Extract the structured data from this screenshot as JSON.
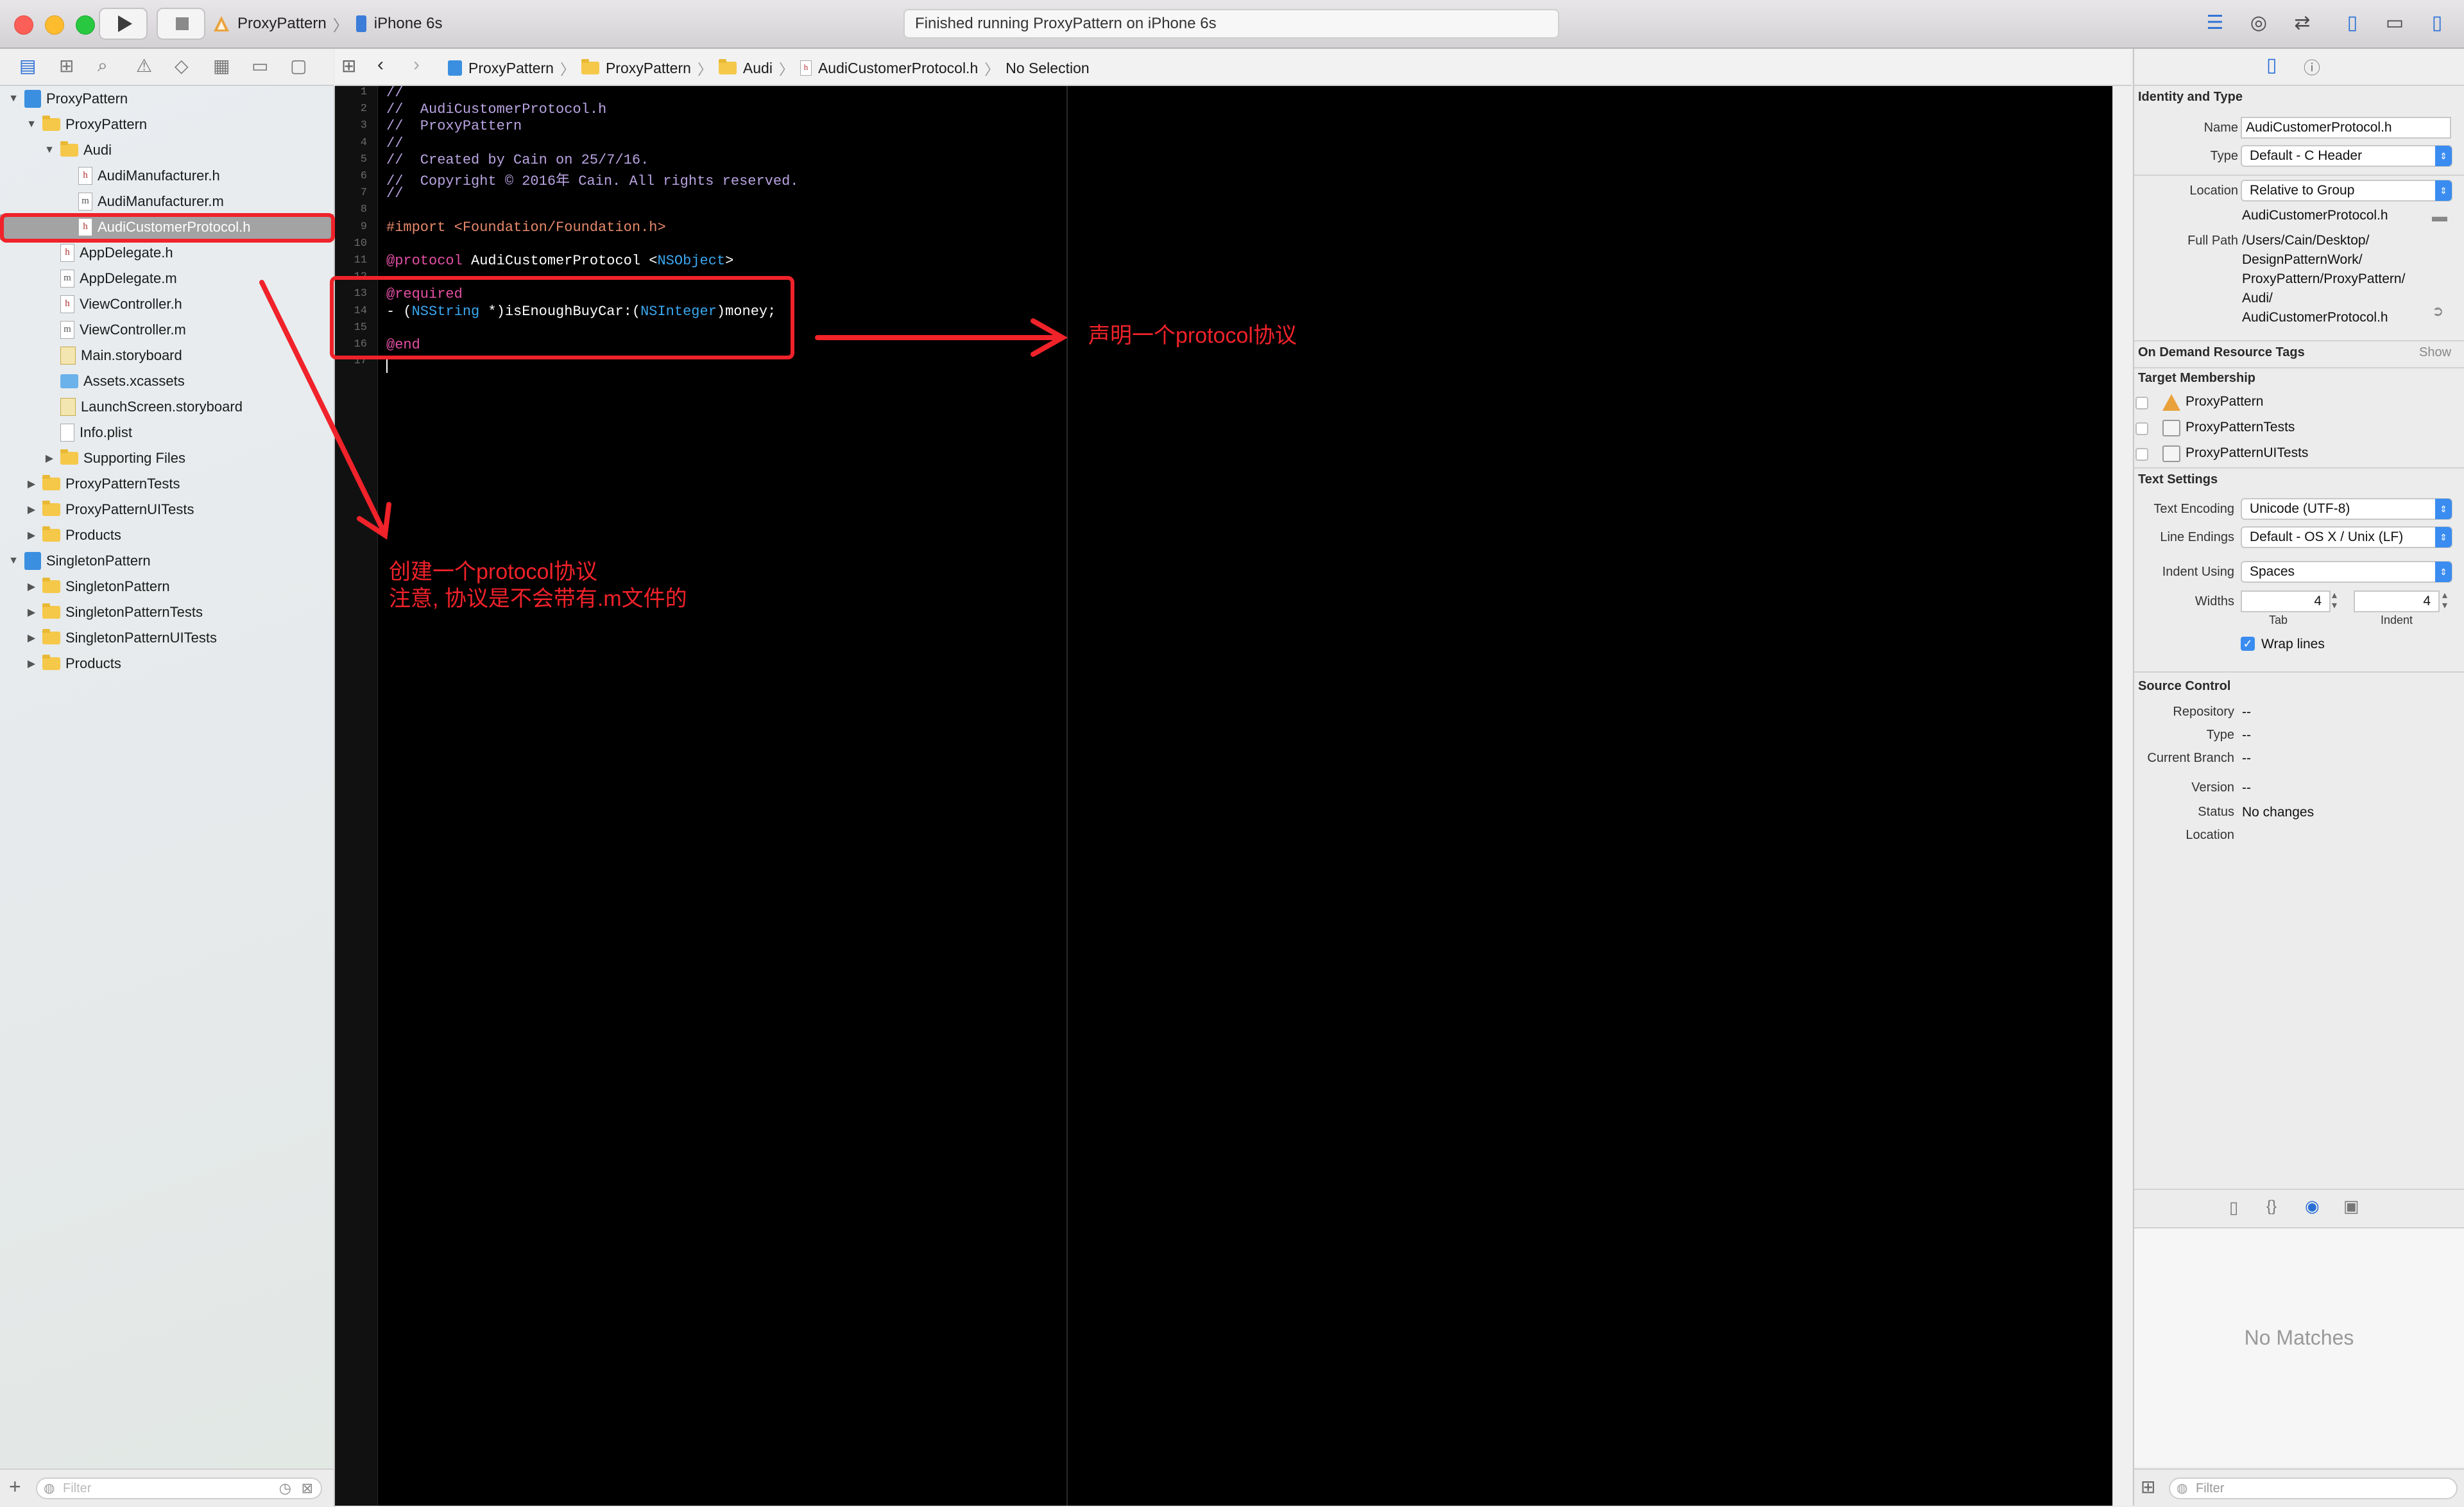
{
  "toolbar": {
    "scheme_name": "ProxyPattern",
    "device_name": "iPhone 6s",
    "status_text": "Finished running ProxyPattern on iPhone 6s"
  },
  "navigator": {
    "items": [
      {
        "label": "ProxyPattern",
        "indent": 0,
        "kind": "project",
        "disclosure": "▼"
      },
      {
        "label": "ProxyPattern",
        "indent": 1,
        "kind": "folder",
        "disclosure": "▼"
      },
      {
        "label": "Audi",
        "indent": 2,
        "kind": "folder",
        "disclosure": "▼"
      },
      {
        "label": "AudiManufacturer.h",
        "indent": 3,
        "kind": "h",
        "disclosure": ""
      },
      {
        "label": "AudiManufacturer.m",
        "indent": 3,
        "kind": "m",
        "disclosure": ""
      },
      {
        "label": "AudiCustomerProtocol.h",
        "indent": 3,
        "kind": "h",
        "disclosure": "",
        "selected": true
      },
      {
        "label": "AppDelegate.h",
        "indent": 2,
        "kind": "h",
        "disclosure": ""
      },
      {
        "label": "AppDelegate.m",
        "indent": 2,
        "kind": "m",
        "disclosure": ""
      },
      {
        "label": "ViewController.h",
        "indent": 2,
        "kind": "h",
        "disclosure": ""
      },
      {
        "label": "ViewController.m",
        "indent": 2,
        "kind": "m",
        "disclosure": ""
      },
      {
        "label": "Main.storyboard",
        "indent": 2,
        "kind": "storyboard",
        "disclosure": ""
      },
      {
        "label": "Assets.xcassets",
        "indent": 2,
        "kind": "assets",
        "disclosure": ""
      },
      {
        "label": "LaunchScreen.storyboard",
        "indent": 2,
        "kind": "storyboard",
        "disclosure": ""
      },
      {
        "label": "Info.plist",
        "indent": 2,
        "kind": "plist",
        "disclosure": ""
      },
      {
        "label": "Supporting Files",
        "indent": 2,
        "kind": "folder",
        "disclosure": "▶"
      },
      {
        "label": "ProxyPatternTests",
        "indent": 1,
        "kind": "folder",
        "disclosure": "▶"
      },
      {
        "label": "ProxyPatternUITests",
        "indent": 1,
        "kind": "folder",
        "disclosure": "▶"
      },
      {
        "label": "Products",
        "indent": 1,
        "kind": "folder",
        "disclosure": "▶"
      },
      {
        "label": "SingletonPattern",
        "indent": 0,
        "kind": "project",
        "disclosure": "▼"
      },
      {
        "label": "SingletonPattern",
        "indent": 1,
        "kind": "folder",
        "disclosure": "▶"
      },
      {
        "label": "SingletonPatternTests",
        "indent": 1,
        "kind": "folder",
        "disclosure": "▶"
      },
      {
        "label": "SingletonPatternUITests",
        "indent": 1,
        "kind": "folder",
        "disclosure": "▶"
      },
      {
        "label": "Products",
        "indent": 1,
        "kind": "folder",
        "disclosure": "▶"
      }
    ],
    "filter_placeholder": "Filter"
  },
  "jumpbar": {
    "crumbs": [
      "ProxyPattern",
      "ProxyPattern",
      "Audi",
      "AudiCustomerProtocol.h",
      "No Selection"
    ]
  },
  "editor": {
    "lines": [
      "//",
      "//  AudiCustomerProtocol.h",
      "//  ProxyPattern",
      "//",
      "//  Created by Cain on 25/7/16.",
      "//  Copyright © 2016年 Cain. All rights reserved.",
      "//",
      "",
      "#import <Foundation/Foundation.h>",
      "",
      "@protocol AudiCustomerProtocol <NSObject>",
      "",
      "@required",
      "- (NSString *)isEnoughBuyCar:(NSInteger)money;",
      "",
      "@end",
      ""
    ]
  },
  "annotations": {
    "right_note": "声明一个protocol协议",
    "left_note": "创建一个protocol协议\n注意, 协议是不会带有.m文件的"
  },
  "inspector": {
    "identity_title": "Identity and Type",
    "name_label": "Name",
    "name_value": "AudiCustomerProtocol.h",
    "type_label": "Type",
    "type_value": "Default - C Header",
    "location_label": "Location",
    "location_value": "Relative to Group",
    "location_file": "AudiCustomerProtocol.h",
    "full_path_label": "Full Path",
    "full_path_lines": [
      "/Users/Cain/Desktop/",
      "DesignPatternWork/",
      "ProxyPattern/ProxyPattern/",
      "Audi/",
      "AudiCustomerProtocol.h"
    ],
    "odr_title": "On Demand Resource Tags",
    "odr_show": "Show",
    "target_title": "Target Membership",
    "targets": [
      "ProxyPattern",
      "ProxyPatternTests",
      "ProxyPatternUITests"
    ],
    "text_settings_title": "Text Settings",
    "text_encoding_label": "Text Encoding",
    "text_encoding_value": "Unicode (UTF-8)",
    "line_endings_label": "Line Endings",
    "line_endings_value": "Default - OS X / Unix (LF)",
    "indent_using_label": "Indent Using",
    "indent_using_value": "Spaces",
    "widths_label": "Widths",
    "tab_value": "4",
    "indent_value": "4",
    "tab_label": "Tab",
    "indent_label": "Indent",
    "wrap_lines_label": "Wrap lines",
    "source_control_title": "Source Control",
    "repository_label": "Repository",
    "repository_value": "--",
    "sc_type_label": "Type",
    "sc_type_value": "--",
    "branch_label": "Current Branch",
    "branch_value": "--",
    "version_label": "Version",
    "version_value": "--",
    "status_label": "Status",
    "status_value": "No changes",
    "sc_location_label": "Location",
    "library_empty": "No Matches",
    "library_filter_placeholder": "Filter"
  }
}
